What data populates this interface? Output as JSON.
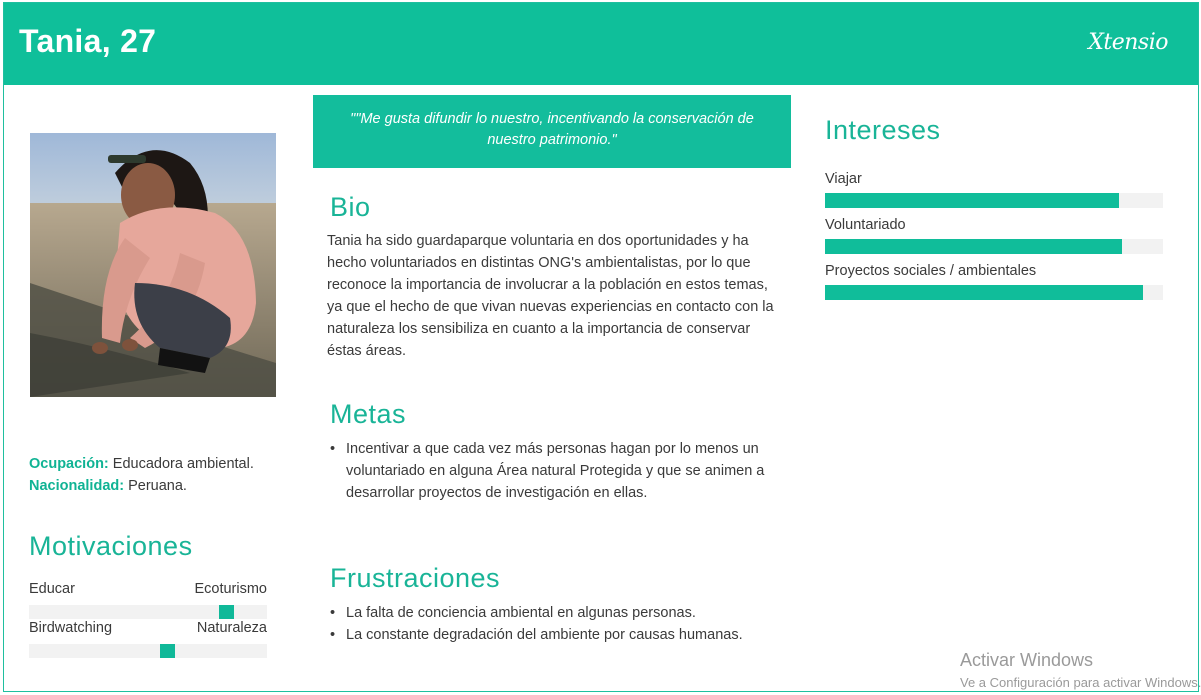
{
  "header": {
    "name": "Tania, 27",
    "logo": "Xtensio"
  },
  "colors": {
    "accent": "#0fbf9a",
    "heading": "#19b497",
    "track": "#f2f2f2"
  },
  "profile": {
    "photo_icon": "person-photo",
    "occupation_label": "Ocupación:",
    "occupation_value": "Educadora ambiental.",
    "nationality_label": "Nacionalidad:",
    "nationality_value": "Peruana."
  },
  "motivaciones": {
    "title": "Motivaciones",
    "sliders": [
      {
        "left": "Educar",
        "right": "Ecoturismo",
        "level": 0.83
      },
      {
        "left": "Birdwatching",
        "right": "Naturaleza",
        "level": 0.58
      }
    ]
  },
  "quote": "\"\"Me gusta difundir lo nuestro, incentivando la conservación de nuestro patrimonio.\"",
  "bio": {
    "title": "Bio",
    "text": "Tania ha sido guardaparque voluntaria en dos oportunidades y ha hecho voluntariados en distintas ONG's ambientalistas, por lo que reconoce la importancia de involucrar a la población en estos temas, ya que el hecho de que vivan nuevas experiencias en contacto con la naturaleza los sensibiliza en cuanto a la importancia de conservar éstas áreas."
  },
  "metas": {
    "title": "Metas",
    "items": [
      "Incentivar a que cada vez más personas hagan por lo menos un voluntariado en alguna Área natural Protegida y que se animen a desarrollar proyectos de investigación en ellas."
    ]
  },
  "frustraciones": {
    "title": "Frustraciones",
    "items": [
      "La falta de conciencia ambiental en algunas personas.",
      "La constante degradación del ambiente por causas humanas."
    ]
  },
  "intereses": {
    "title": "Intereses",
    "items": [
      {
        "label": "Viajar",
        "level": 0.87
      },
      {
        "label": "Voluntariado",
        "level": 0.88
      },
      {
        "label": "Proyectos sociales / ambientales",
        "level": 0.94
      }
    ]
  },
  "watermark": {
    "line1": "Activar Windows",
    "line2": "Ve a Configuración para activar Windows."
  }
}
